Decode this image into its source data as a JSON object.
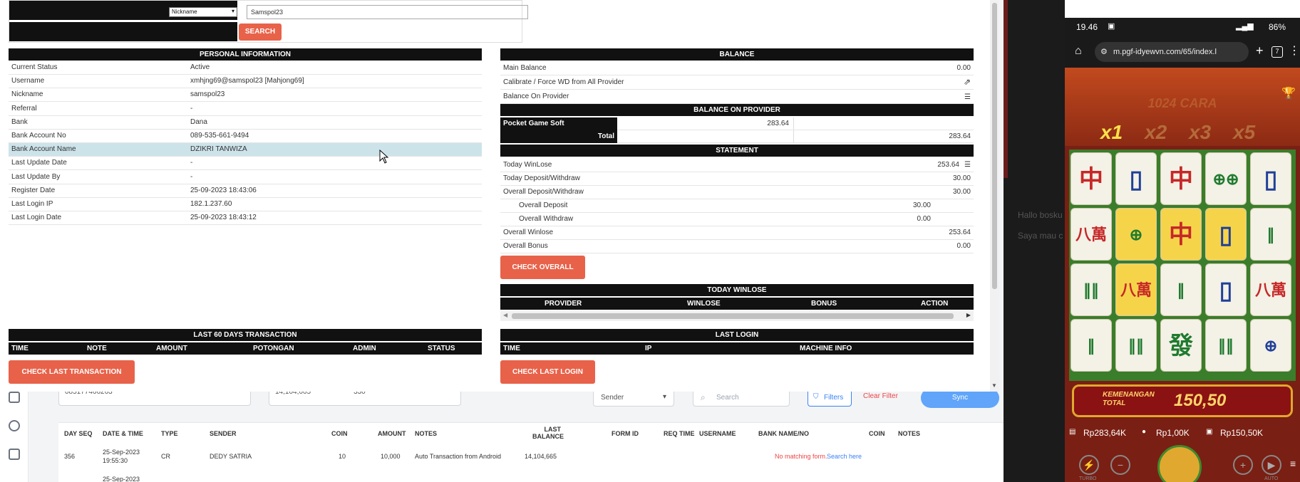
{
  "background": {
    "card_values": [
      "085177466263",
      "14,104,665",
      "330"
    ],
    "sender_select": "Sender",
    "search_placeholder": "Search",
    "filters_label": "Filters",
    "clear_filter_label": "Clear Filter",
    "sync_label": "Sync",
    "table_headers": [
      "DAY SEQ",
      "DATE & TIME",
      "TYPE",
      "SENDER",
      "COIN",
      "AMOUNT",
      "NOTES",
      "LAST BALANCE",
      "FORM ID",
      "REQ TIME",
      "USERNAME",
      "BANK NAME/NO",
      "COIN",
      "NOTES"
    ],
    "row": {
      "seq": "356",
      "date": "25-Sep-2023",
      "time": "19:55:30",
      "type": "CR",
      "sender": "DEDY SATRIA",
      "coin": "10",
      "amount": "10,000",
      "notes": "Auto Transaction from Android",
      "balance": "14,104,665",
      "no_match": "No matching form.",
      "search_here": "Search here"
    },
    "next_row_date": "25-Sep-2023",
    "side_texts": [
      "Hallo bosku",
      "Saya mau c"
    ]
  },
  "search": {
    "type_selected": "Nickname",
    "value": "Samspol23",
    "button": "SEARCH"
  },
  "personal": {
    "title": "PERSONAL INFORMATION",
    "rows": [
      {
        "k": "Current Status",
        "v": "Active"
      },
      {
        "k": "Username",
        "v": "xmhjng69@samspol23  [Mahjong69]"
      },
      {
        "k": "Nickname",
        "v": "samspol23"
      },
      {
        "k": "Referral",
        "v": "-"
      },
      {
        "k": "Bank",
        "v": "Dana"
      },
      {
        "k": "Bank Account No",
        "v": "089-535-661-9494"
      },
      {
        "k": "Bank Account Name",
        "v": "DZIKRI TANWIZA"
      },
      {
        "k": "Last Update Date",
        "v": "-"
      },
      {
        "k": "Last Update By",
        "v": "-"
      },
      {
        "k": "Register Date",
        "v": "25-09-2023 18:43:06"
      },
      {
        "k": "Last Login IP",
        "v": "182.1.237.60"
      },
      {
        "k": "Last Login Date",
        "v": "25-09-2023 18:43:12"
      }
    ]
  },
  "balance": {
    "title": "BALANCE",
    "main_label": "Main Balance",
    "main_value": "0.00",
    "calibrate_label": "Calibrate / Force WD from All Provider",
    "on_provider_label": "Balance On Provider",
    "provider_title": "BALANCE ON PROVIDER",
    "provider_name": "Pocket Game Soft",
    "provider_value": "283.64",
    "total_label": "Total",
    "total_value": "283.64"
  },
  "statement": {
    "title": "STATEMENT",
    "today_winlose_label": "Today WinLose",
    "today_winlose": "253.64",
    "today_dw_label": "Today Deposit/Withdraw",
    "today_dw": "30.00",
    "overall_dw_label": "Overall Deposit/Withdraw",
    "overall_dw": "30.00",
    "overall_deposit_label": "Overall Deposit",
    "overall_deposit": "30.00",
    "overall_withdraw_label": "Overall Withdraw",
    "overall_withdraw": "0.00",
    "overall_winlose_label": "Overall Winlose",
    "overall_winlose": "253.64",
    "overall_bonus_label": "Overall Bonus",
    "overall_bonus": "0.00",
    "check_overall": "CHECK OVERALL"
  },
  "today_winlose": {
    "title": "TODAY WINLOSE",
    "columns": [
      "PROVIDER",
      "WINLOSE",
      "BONUS",
      "ACTION"
    ]
  },
  "last60": {
    "title": "LAST 60 DAYS TRANSACTION",
    "columns": [
      "TIME",
      "NOTE",
      "AMOUNT",
      "POTONGAN",
      "ADMIN",
      "STATUS"
    ],
    "button": "CHECK LAST TRANSACTION"
  },
  "last_login": {
    "title": "LAST LOGIN",
    "columns": [
      "TIME",
      "IP",
      "MACHINE INFO"
    ],
    "button": "CHECK LAST LOGIN"
  },
  "phone": {
    "time": "19.46",
    "battery": "86%",
    "url": "m.pgf-idyewvn.com/65/index.l",
    "tab_count": "7",
    "game_subtitle": "1024 CARA",
    "multipliers": [
      "x1",
      "x2",
      "x3",
      "x5"
    ],
    "win_label": "KEMENANGAN TOTAL",
    "win_value": "150,50",
    "balance": "Rp283,64K",
    "bet": "Rp1,00K",
    "win": "Rp150,50K",
    "turbo": "TURBO",
    "auto": "AUTO"
  }
}
